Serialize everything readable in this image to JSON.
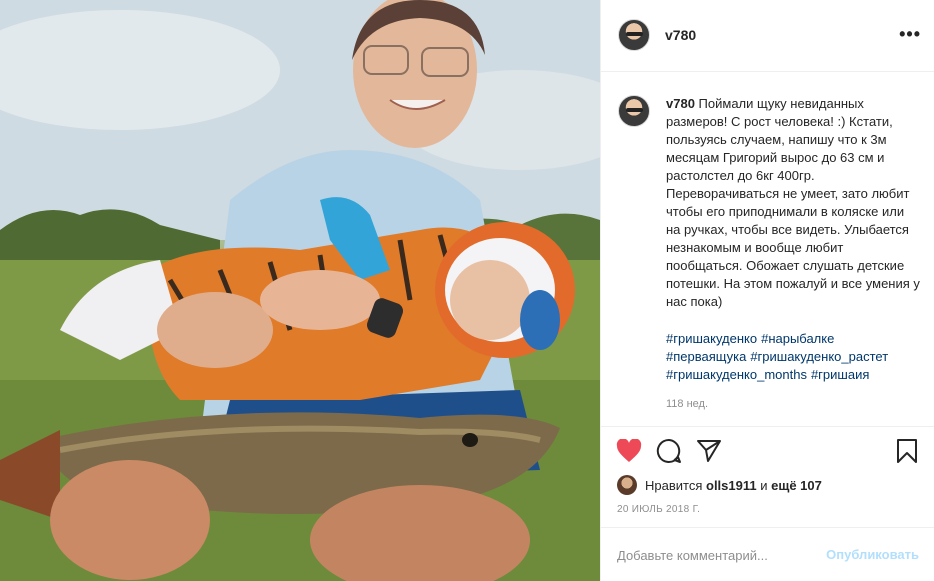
{
  "post": {
    "username": "v780",
    "more_label": "•••",
    "caption": "Поймали щуку невиданных размеров! С рост человека! :) Кстати, пользуясь случаем, напишу что к 3м месяцам Григорий вырос до 63 см и растолстел до 6кг 400гр. Переворачиваться не умеет, зато любит чтобы его приподнимали в коляске или на ручках, чтобы все видеть. Улыбается незнакомым и вообще любит пообщаться. Обожает слушать детские потешки. На этом пожалуй и все умения у нас пока)",
    "hashtags": [
      "#гришакуденко",
      "#нарыбалке",
      "#перваящука",
      "#гришакуденко_растет",
      "#гришакуденко_months",
      "#гришаия"
    ],
    "caption_time": "118 нед."
  },
  "icons": {
    "like": "heart-icon",
    "comment": "comment-icon",
    "share": "share-icon",
    "save": "bookmark-icon"
  },
  "likes": {
    "prefix": "Нравится",
    "user": "olls1911",
    "connector": "и",
    "rest": "ещё 107"
  },
  "date": "20 ИЮЛЬ 2018 Г.",
  "comment_box": {
    "placeholder": "Добавьте комментарий...",
    "post_label": "Опубликовать"
  },
  "colors": {
    "like": "#ed4956",
    "link": "#00376b",
    "post_disabled": "#b2dffc"
  }
}
